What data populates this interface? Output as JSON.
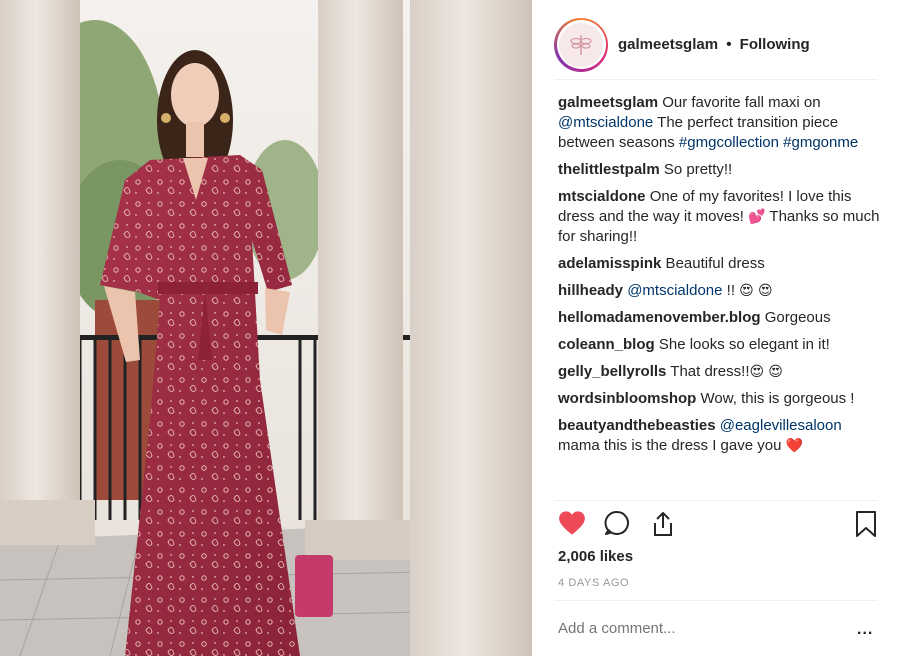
{
  "header": {
    "username": "galmeetsglam",
    "separator": "•",
    "follow_status": "Following"
  },
  "comments": [
    {
      "user": "galmeetsglam",
      "parts": [
        {
          "t": "text",
          "v": " Our favorite fall maxi on "
        },
        {
          "t": "mention",
          "v": "@mtscialdone"
        },
        {
          "t": "text",
          "v": " The perfect transition piece between seasons "
        },
        {
          "t": "mention",
          "v": "#gmgcollection"
        },
        {
          "t": "text",
          "v": " "
        },
        {
          "t": "mention",
          "v": "#gmgonme"
        }
      ]
    },
    {
      "user": "thelittlestpalm",
      "parts": [
        {
          "t": "text",
          "v": " So pretty!!"
        }
      ]
    },
    {
      "user": "mtscialdone",
      "parts": [
        {
          "t": "text",
          "v": " One of my favorites! I love this dress and the way it moves! "
        },
        {
          "t": "emoji",
          "v": "💕"
        },
        {
          "t": "text",
          "v": "  Thanks so much for sharing!!"
        }
      ]
    },
    {
      "user": "adelamisspink",
      "parts": [
        {
          "t": "text",
          "v": " Beautiful dress"
        }
      ]
    },
    {
      "user": "hillheady",
      "parts": [
        {
          "t": "text",
          "v": " "
        },
        {
          "t": "mention",
          "v": "@mtscialdone"
        },
        {
          "t": "text",
          "v": " !! "
        },
        {
          "t": "emoji",
          "v": "😍"
        },
        {
          "t": "text",
          "v": " "
        },
        {
          "t": "emoji",
          "v": "😍"
        }
      ]
    },
    {
      "user": "hellomadamenovember.blog",
      "parts": [
        {
          "t": "text",
          "v": " Gorgeous"
        }
      ]
    },
    {
      "user": "coleann_blog",
      "parts": [
        {
          "t": "text",
          "v": " She looks so elegant in it!"
        }
      ]
    },
    {
      "user": "gelly_bellyrolls",
      "parts": [
        {
          "t": "text",
          "v": " That dress!!"
        },
        {
          "t": "emoji",
          "v": "😍"
        },
        {
          "t": "text",
          "v": " "
        },
        {
          "t": "emoji",
          "v": "😍"
        }
      ]
    },
    {
      "user": "wordsinbloomshop",
      "parts": [
        {
          "t": "text",
          "v": " Wow, this is gorgeous !"
        }
      ]
    },
    {
      "user": "beautyandthebeasties",
      "parts": [
        {
          "t": "text",
          "v": " "
        },
        {
          "t": "mention",
          "v": "@eaglevillesaloon"
        },
        {
          "t": "text",
          "v": " mama this is the dress I gave you "
        },
        {
          "t": "emoji",
          "v": "❤️"
        }
      ]
    }
  ],
  "actions": {
    "like_icon": "heart-filled-icon",
    "comment_icon": "comment-icon",
    "share_icon": "share-icon",
    "save_icon": "bookmark-icon",
    "like_color": "#ed4956"
  },
  "likes": "2,006 likes",
  "date": "4 DAYS AGO",
  "add_comment": {
    "placeholder": "Add a comment...",
    "more": "..."
  }
}
